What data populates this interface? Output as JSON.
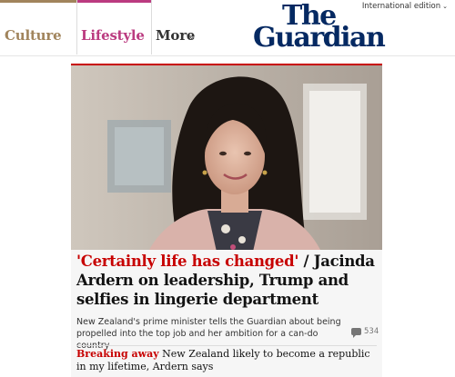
{
  "nav": {
    "items": [
      {
        "label": "Culture",
        "color": "#a1845c"
      },
      {
        "label": "Lifestyle",
        "color": "#bb3b80"
      },
      {
        "label": "More"
      }
    ]
  },
  "header": {
    "edition_label": "International edition",
    "logo_line1": "The",
    "logo_line2": "Guardian",
    "brand_color": "#052962"
  },
  "story": {
    "kicker": "'Certainly life has changed'",
    "separator": " / ",
    "headline": "Jacinda Ardern on leadership, Trump and selfies in lingerie department",
    "standfirst": "New Zealand's prime minister tells the Guardian about being propelled into the top job and her ambition for a can-do country",
    "comment_count": "534",
    "accent_color": "#c70000"
  },
  "sublink": {
    "kicker": "Breaking away",
    "text": "New Zealand likely to become a republic in my lifetime, Ardern says"
  }
}
